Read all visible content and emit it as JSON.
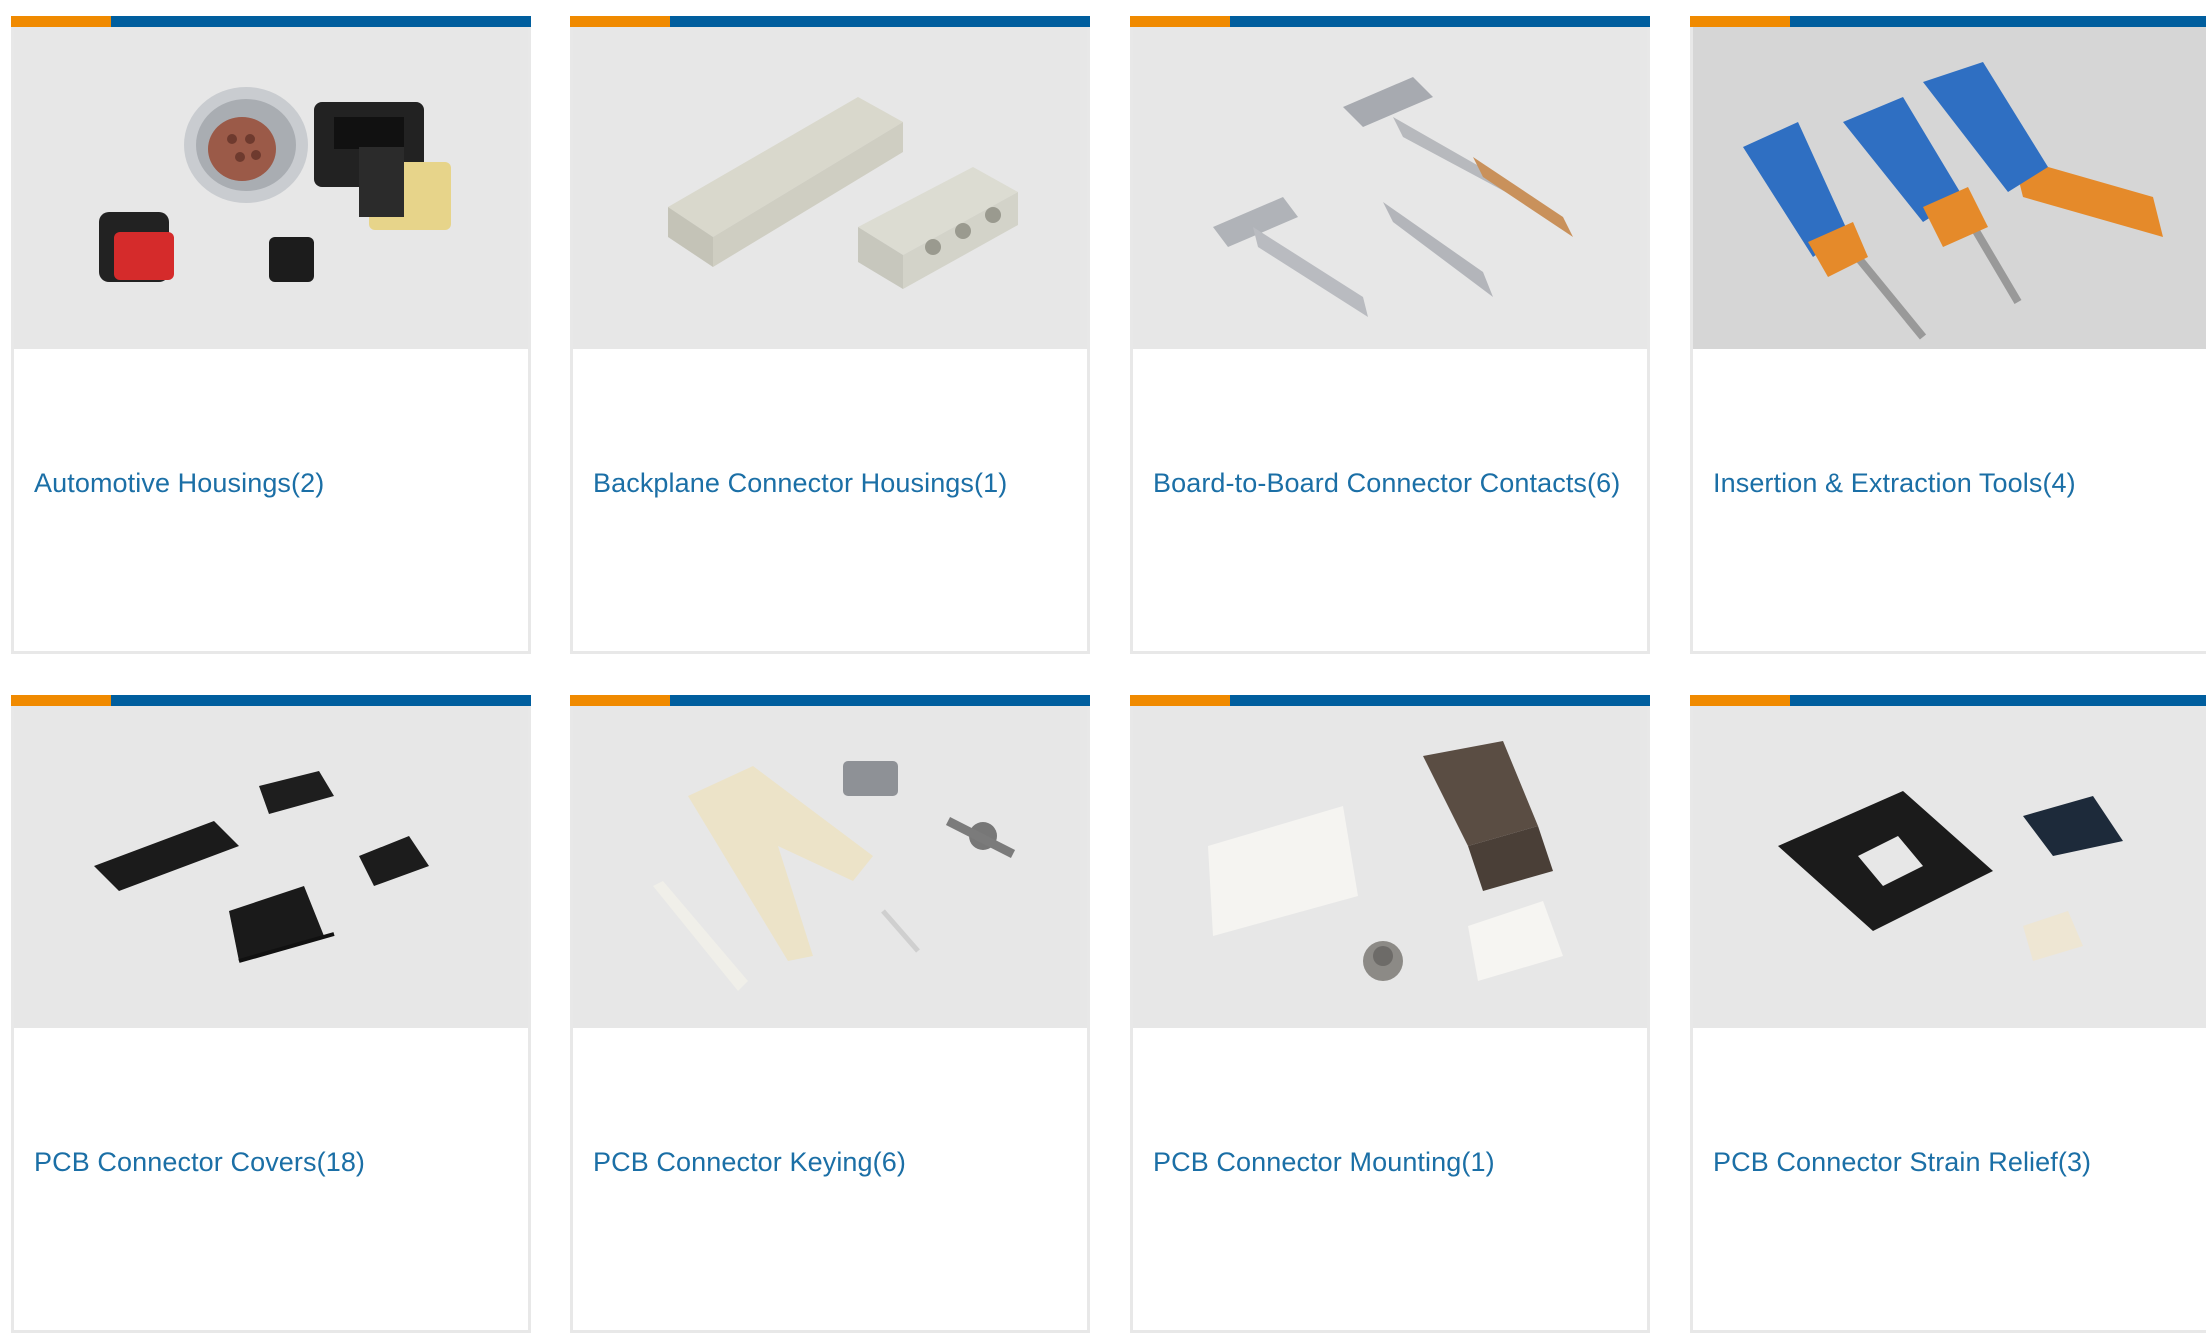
{
  "colors": {
    "accent_orange": "#f08a00",
    "accent_blue": "#005e9e",
    "link_blue": "#1b6fa6"
  },
  "categories": [
    {
      "label": "Automotive Housings(2)",
      "image": "automotive-housings-photo"
    },
    {
      "label": "Backplane Connector Housings(1)",
      "image": "backplane-housings-photo"
    },
    {
      "label": "Board-to-Board Connector Contacts(6)",
      "image": "board-contacts-photo"
    },
    {
      "label": "Insertion & Extraction Tools(4)",
      "image": "extraction-tools-photo"
    },
    {
      "label": "PCB Connector Covers(18)",
      "image": "connector-covers-photo"
    },
    {
      "label": "PCB Connector Keying(6)",
      "image": "connector-keying-photo"
    },
    {
      "label": "PCB Connector Mounting(1)",
      "image": "connector-mounting-photo"
    },
    {
      "label": "PCB Connector Strain Relief(3)",
      "image": "strain-relief-photo"
    }
  ]
}
